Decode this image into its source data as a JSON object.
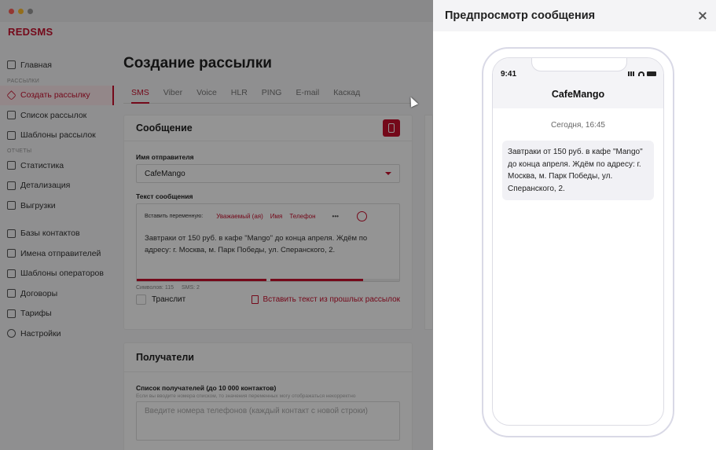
{
  "app": {
    "logo": "REDSMS",
    "sidebar": {
      "main_item": "Главная",
      "section_mailings": "Рассылки",
      "items_mailings": [
        "Создать рассылку",
        "Список рассылок",
        "Шаблоны рассылок"
      ],
      "section_reports": "Отчеты",
      "items_reports": [
        "Статистика",
        "Детализация",
        "Выгрузки"
      ],
      "items_other": [
        "Базы контактов",
        "Имена отправителей",
        "Шаблоны операторов",
        "Договоры",
        "Тарифы",
        "Настройки"
      ]
    },
    "page_title": "Создание рассылки",
    "tabs": [
      "SMS",
      "Viber",
      "Voice",
      "HLR",
      "PING",
      "E-mail",
      "Каскад"
    ],
    "message_card": {
      "title": "Сообщение",
      "sender_label": "Имя отправителя",
      "sender_value": "CafeMango",
      "text_label": "Текст сообщения",
      "insert_variable_label": "Вставить переменную:",
      "variables": [
        "Уважаемый (ая)",
        "Имя",
        "Телефон"
      ],
      "more": "•••",
      "text": "Завтраки от 150 руб. в кафе \"Mango\" до конца апреля. Ждём по адресу: г. Москва, м. Парк Победы, ул. Сперанского, 2.",
      "chars": "Символов: 115",
      "sms": "SMS: 2",
      "progress": [
        1.0,
        0.72
      ],
      "translit": "Транслит",
      "paste_prev": "Вставить текст из прошлых рассылок"
    },
    "recipients_card": {
      "title": "Получатели",
      "list_label": "Список получателей (до 10 000 контактов)",
      "hint": "Если вы вводите номера списком, то значения переменных могу отображаться некорректно",
      "placeholder": "Введите номера телефонов (каждый контакт с новой строки)"
    }
  },
  "preview": {
    "title": "Предпросмотр сообщения",
    "phone": {
      "time": "9:41",
      "sender": "CafeMango",
      "date": "Сегодня, 16:45",
      "message": "Завтраки от 150 руб. в кафе \"Mango\" до конца апреля. Ждём по адресу: г. Москва, м. Парк Победы, ул. Сперанского, 2."
    }
  },
  "colors": {
    "accent": "#c8102e"
  }
}
